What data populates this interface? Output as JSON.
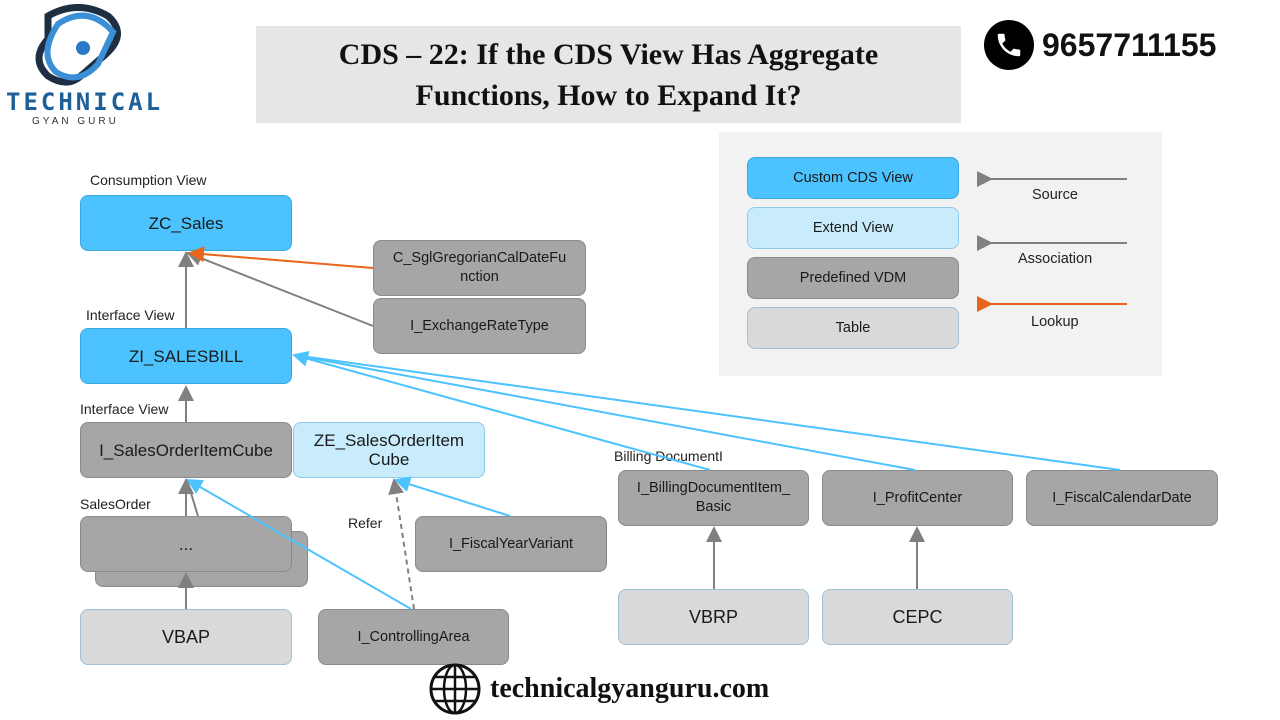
{
  "brand": {
    "logo_main": "TECHNICAL",
    "logo_sub": "GYAN GURU",
    "phone": "9657711155",
    "website": "technicalgyanguru.com"
  },
  "header": {
    "title": "CDS – 22: If the CDS View Has Aggregate Functions, How to Expand It?"
  },
  "legend": {
    "boxes": [
      {
        "label": "Custom CDS View",
        "kind": "custom"
      },
      {
        "label": "Extend View",
        "kind": "extend"
      },
      {
        "label": "Predefined VDM",
        "kind": "vdm"
      },
      {
        "label": "Table",
        "kind": "table"
      }
    ],
    "arrows": [
      {
        "label": "Source",
        "color": "#808080"
      },
      {
        "label": "Association",
        "color": "#808080"
      },
      {
        "label": "Lookup",
        "color": "#e8651a"
      }
    ]
  },
  "diagram": {
    "section_labels": {
      "consumption": "Consumption View",
      "interface1": "Interface View",
      "interface2": "Interface View",
      "sales_order": "SalesOrder",
      "billing": "Billing DocumentI",
      "refer": "Refer"
    },
    "nodes": {
      "zc_sales": "ZC_Sales",
      "zi_salesbill": "ZI_SALESBILL",
      "cal_date_func": "C_SglGregorianCalDateFu nction",
      "exchange_rate": "I_ExchangeRateType",
      "so_item_cube": "I_SalesOrderItemCube",
      "ze_so_item_cube": "ZE_SalesOrderItem Cube",
      "ellipsis": "...",
      "vbap": "VBAP",
      "controlling_area": "I_ControllingArea",
      "fiscal_year_variant": "I_FiscalYearVariant",
      "billing_item": "I_BillingDocumentItem_ Basic",
      "profit_center": "I_ProfitCenter",
      "fiscal_cal_date": "I_FiscalCalendarDate",
      "vbrp": "VBRP",
      "cepc": "CEPC"
    },
    "colors": {
      "custom": "#4cc3ff",
      "extend": "#c9ecfc",
      "vdm": "#a6a6a6",
      "table": "#d9d9d9",
      "source_arrow": "#808080",
      "association_arrow": "#4cc3ff",
      "lookup_arrow": "#e8651a"
    }
  }
}
